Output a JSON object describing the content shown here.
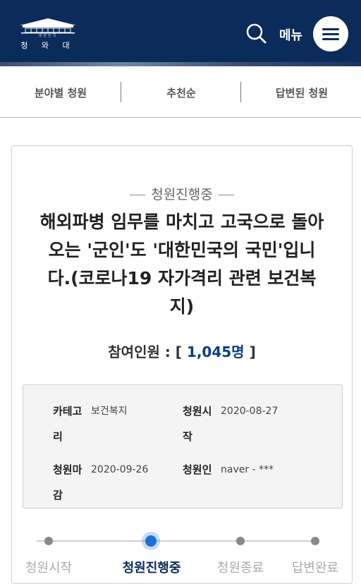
{
  "header": {
    "logo_text": "청 와 대",
    "logo_subtext": "대한민국",
    "search_icon": "search-icon",
    "menu_label": "메뉴",
    "menu_icon": "hamburger-icon",
    "colors": {
      "header_bg": "#0b2b5b",
      "accent": "#0b3d86"
    }
  },
  "tabs": [
    {
      "label": "분야별 청원"
    },
    {
      "label": "추천순"
    },
    {
      "label": "답변된 청원"
    }
  ],
  "petition": {
    "status": "청원진행중",
    "title": "해외파병 임무를 마치고 고국으로 돌아오는 '군인'도 '대한민국의 국민'입니다.(코로나19 자가격리 관련 보건복지)",
    "participants_prefix": "참여인원 : [",
    "participants_count": "1,045명",
    "participants_suffix": "]",
    "info": {
      "category_label": "카테고리",
      "category_value": "보건복지",
      "start_label": "청원시작",
      "start_value": "2020-08-27",
      "end_label": "청원마감",
      "end_value": "2020-09-26",
      "petitioner_label": "청원인",
      "petitioner_value": "naver - ***"
    }
  },
  "progress": {
    "steps": [
      "청원시작",
      "청원진행중",
      "청원종료",
      "답변완료"
    ],
    "active_index": 1
  }
}
